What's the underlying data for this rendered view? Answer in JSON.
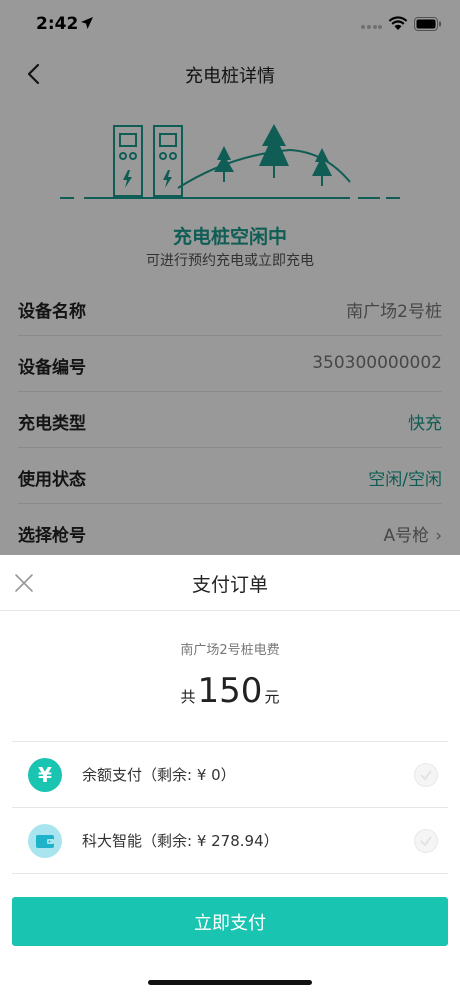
{
  "status_bar": {
    "time": "2:42"
  },
  "nav": {
    "title": "充电桩详情"
  },
  "charger_status": {
    "title": "充电桩空闲中",
    "subtitle": "可进行预约充电或立即充电"
  },
  "info_rows": [
    {
      "label": "设备名称",
      "value": "南广场2号桩"
    },
    {
      "label": "设备编号",
      "value": "350300000002"
    },
    {
      "label": "充电类型",
      "value": "快充"
    },
    {
      "label": "使用状态",
      "value": "空闲/空闲"
    },
    {
      "label": "选择枪号",
      "value": "A号枪"
    }
  ],
  "sheet": {
    "title": "支付订单",
    "description": "南广场2号桩电费",
    "amount_prefix": "共",
    "amount": "150",
    "amount_suffix": "元",
    "methods": [
      {
        "icon": "yuan-icon",
        "label": "余额支付（剩余: ¥ 0）"
      },
      {
        "icon": "wallet-icon",
        "label": "科大智能（剩余: ¥ 278.94）"
      }
    ],
    "pay_button": "立即支付"
  },
  "colors": {
    "accent": "#19c4b1",
    "status_green": "#1a9c8c"
  }
}
